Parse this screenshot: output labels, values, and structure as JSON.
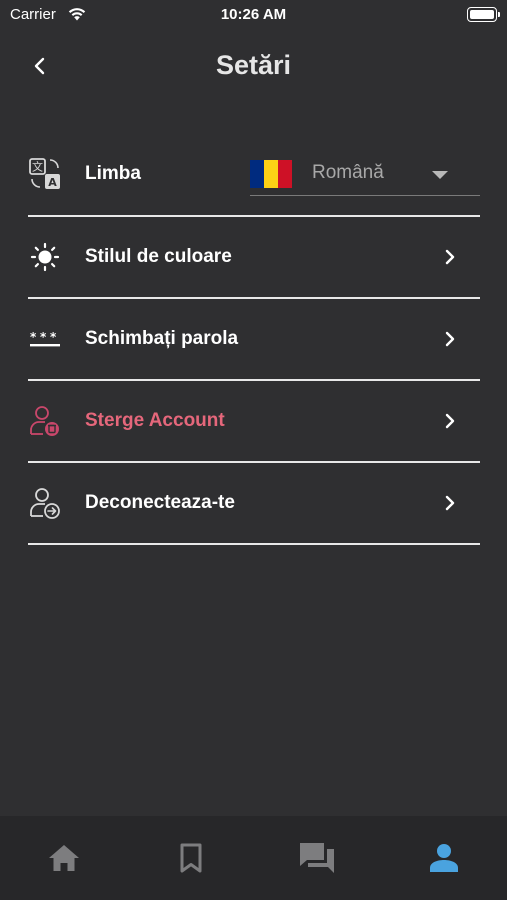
{
  "status_bar": {
    "carrier": "Carrier",
    "time": "10:26 AM"
  },
  "header": {
    "title": "Setări",
    "back_icon": "chevron-left-icon"
  },
  "settings": {
    "language": {
      "label": "Limba",
      "icon": "translate-icon",
      "selected_value": "Română",
      "flag_colors": [
        "#002b7f",
        "#fcd116",
        "#ce1126"
      ]
    },
    "items": [
      {
        "label": "Stilul de culoare",
        "icon": "sun-icon"
      },
      {
        "label": "Schimbați parola",
        "icon": "password-icon"
      },
      {
        "label": "Sterge Account",
        "icon": "delete-user-icon",
        "color": "#e5677b"
      },
      {
        "label": "Deconecteaza-te",
        "icon": "logout-user-icon"
      }
    ]
  },
  "tab_bar": {
    "tabs": [
      {
        "icon": "home-icon",
        "active": false
      },
      {
        "icon": "bookmark-icon",
        "active": false
      },
      {
        "icon": "chat-icon",
        "active": false
      },
      {
        "icon": "profile-icon",
        "active": true
      }
    ],
    "active_color": "#4aa3df",
    "inactive_color": "#7d7d7f"
  }
}
